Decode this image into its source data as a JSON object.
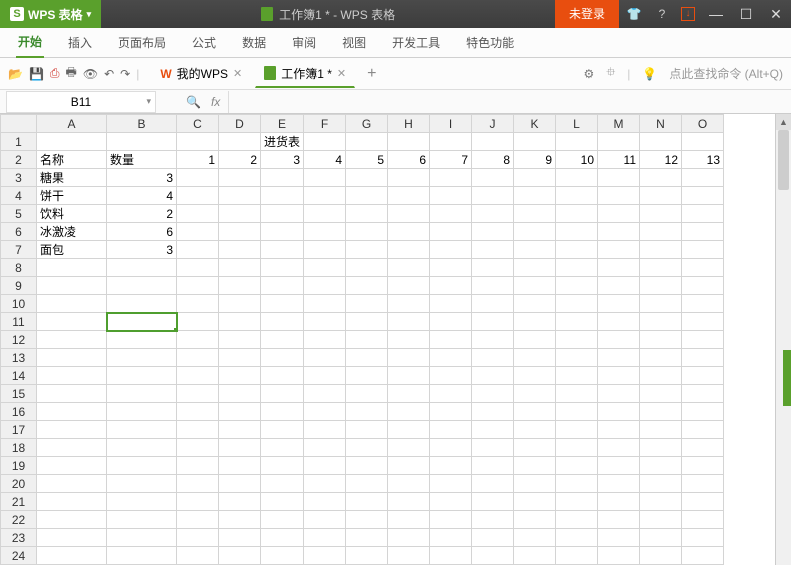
{
  "app": {
    "name": "WPS 表格",
    "doc_title": "工作簿1 * - WPS 表格",
    "login": "未登录"
  },
  "ribbon": {
    "tabs": [
      "开始",
      "插入",
      "页面布局",
      "公式",
      "数据",
      "审阅",
      "视图",
      "开发工具",
      "特色功能"
    ]
  },
  "file_tabs": {
    "wps": "我的WPS",
    "doc": "工作簿1 *"
  },
  "search_hint": "点此查找命令 (Alt+Q)",
  "namebox": "B11",
  "columns": [
    "A",
    "B",
    "C",
    "D",
    "E",
    "F",
    "G",
    "H",
    "I",
    "J",
    "K",
    "L",
    "M",
    "N",
    "O"
  ],
  "rows_count": 24,
  "title_cell": "进货表",
  "data": {
    "r2": {
      "A": "名称",
      "B": "数量",
      "C": "1",
      "D": "2",
      "E": "3",
      "F": "4",
      "G": "5",
      "H": "6",
      "I": "7",
      "J": "8",
      "K": "9",
      "L": "10",
      "M": "11",
      "N": "12",
      "O": "13"
    },
    "r3": {
      "A": "糖果",
      "B": "3"
    },
    "r4": {
      "A": "饼干",
      "B": "4"
    },
    "r5": {
      "A": "饮料",
      "B": "2"
    },
    "r6": {
      "A": "冰激凌",
      "B": "6"
    },
    "r7": {
      "A": "面包",
      "B": "3"
    }
  },
  "selected": {
    "row": 11,
    "col": "B"
  }
}
